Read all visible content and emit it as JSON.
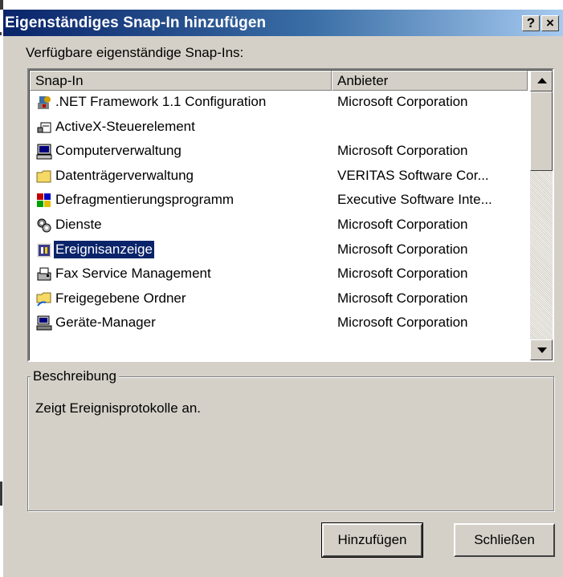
{
  "window": {
    "title": "Eigenständiges Snap-In hinzufügen",
    "help_button": "?",
    "close_button": "×"
  },
  "available_label": "Verfügbare eigenständige Snap-Ins:",
  "list": {
    "columns": [
      "Snap-In",
      "Anbieter"
    ],
    "rows": [
      {
        "name": ".NET Framework 1.1 Configuration",
        "vendor": "Microsoft Corporation",
        "icon": "net-framework-icon"
      },
      {
        "name": "ActiveX-Steuerelement",
        "vendor": "",
        "icon": "activex-control-icon"
      },
      {
        "name": "Computerverwaltung",
        "vendor": "Microsoft Corporation",
        "icon": "computer-icon"
      },
      {
        "name": "Datenträgerverwaltung",
        "vendor": "VERITAS Software Cor...",
        "icon": "folder-icon"
      },
      {
        "name": "Defragmentierungsprogramm",
        "vendor": "Executive Software Inte...",
        "icon": "defrag-icon"
      },
      {
        "name": "Dienste",
        "vendor": "Microsoft Corporation",
        "icon": "services-gears-icon"
      },
      {
        "name": "Ereignisanzeige",
        "vendor": "Microsoft Corporation",
        "icon": "event-viewer-icon",
        "selected": true
      },
      {
        "name": "Fax Service Management",
        "vendor": "Microsoft Corporation",
        "icon": "fax-icon"
      },
      {
        "name": "Freigegebene Ordner",
        "vendor": "Microsoft Corporation",
        "icon": "shared-folder-icon"
      },
      {
        "name": "Geräte-Manager",
        "vendor": "Microsoft Corporation",
        "icon": "device-manager-icon"
      }
    ]
  },
  "description": {
    "legend": "Beschreibung",
    "text": "Zeigt Ereignisprotokolle an."
  },
  "buttons": {
    "add": "Hinzufügen",
    "close": "Schließen"
  },
  "colors": {
    "face": "#d4d0c8",
    "title_start": "#0a246a",
    "title_end": "#a6caf0",
    "selection": "#0a246a"
  }
}
